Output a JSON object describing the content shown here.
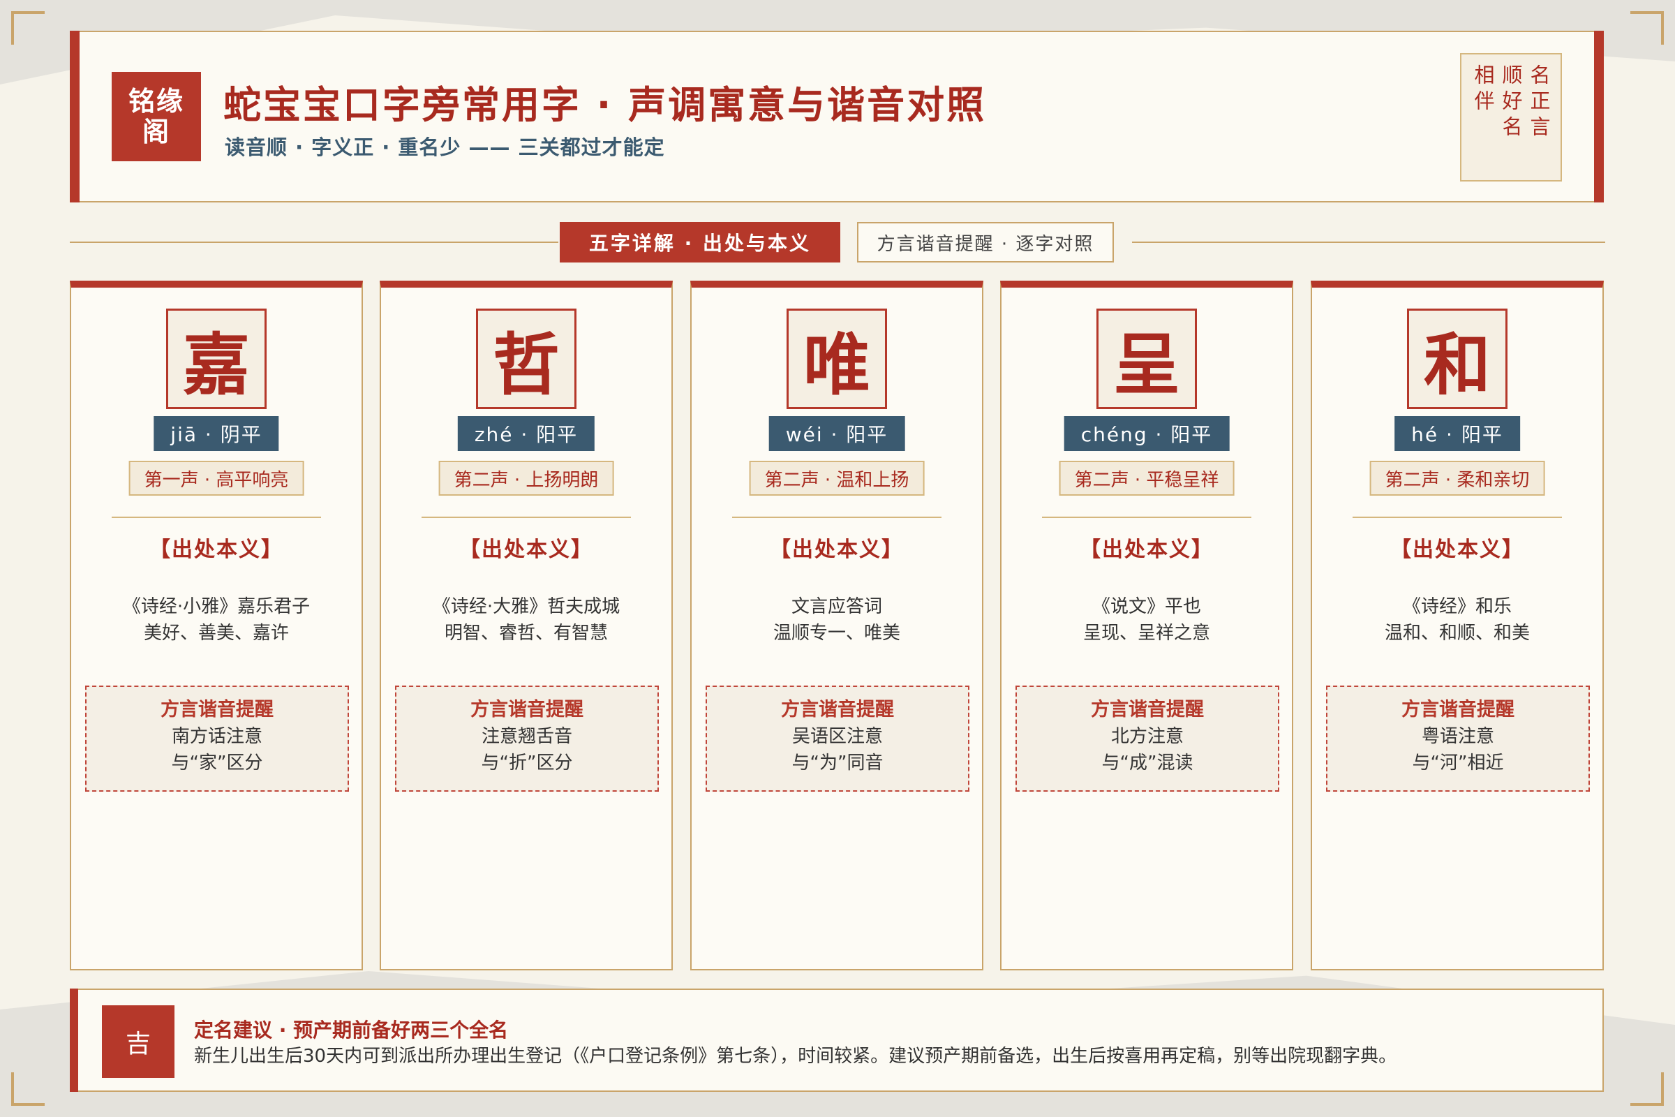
{
  "header": {
    "logo": [
      "铭缘",
      "阁"
    ],
    "title": "蛇宝宝口字旁常用字 · 声调寓意与谐音对照",
    "subtitle": "读音顺 · 字义正 · 重名少 —— 三关都过才能定",
    "seal_columns": [
      "名正言",
      "顺好名",
      "相伴"
    ]
  },
  "tabs": {
    "active": "五字详解 · 出处与本义",
    "inactive": "方言谐音提醒 · 逐字对照"
  },
  "cards": [
    {
      "char": "嘉",
      "pinyin": "jiā · 阴平",
      "tone": "第一声 · 高平响亮",
      "section_title": "【出处本义】",
      "origin": [
        "《诗经·小雅》嘉乐君子",
        "美好、善美、嘉许"
      ],
      "dialect_title": "方言谐音提醒",
      "dialect": [
        "南方话注意",
        "与“家”区分"
      ]
    },
    {
      "char": "哲",
      "pinyin": "zhé · 阳平",
      "tone": "第二声 · 上扬明朗",
      "section_title": "【出处本义】",
      "origin": [
        "《诗经·大雅》哲夫成城",
        "明智、睿哲、有智慧"
      ],
      "dialect_title": "方言谐音提醒",
      "dialect": [
        "注意翘舌音",
        "与“折”区分"
      ]
    },
    {
      "char": "唯",
      "pinyin": "wéi · 阳平",
      "tone": "第二声 · 温和上扬",
      "section_title": "【出处本义】",
      "origin": [
        "文言应答词",
        "温顺专一、唯美"
      ],
      "dialect_title": "方言谐音提醒",
      "dialect": [
        "吴语区注意",
        "与“为”同音"
      ]
    },
    {
      "char": "呈",
      "pinyin": "chéng · 阳平",
      "tone": "第二声 · 平稳呈祥",
      "section_title": "【出处本义】",
      "origin": [
        "《说文》平也",
        "呈现、呈祥之意"
      ],
      "dialect_title": "方言谐音提醒",
      "dialect": [
        "北方注意",
        "与“成”混读"
      ]
    },
    {
      "char": "和",
      "pinyin": "hé · 阳平",
      "tone": "第二声 · 柔和亲切",
      "section_title": "【出处本义】",
      "origin": [
        "《诗经》和乐",
        "温和、和顺、和美"
      ],
      "dialect_title": "方言谐音提醒",
      "dialect": [
        "粤语注意",
        "与“河”相近"
      ]
    }
  ],
  "footer": {
    "badge": "吉",
    "title": "定名建议 · 预产期前备好两三个全名",
    "text": "新生儿出生后30天内可到派出所办理出生登记（《户口登记条例》第七条），时间较紧。建议预产期前备选，出生后按喜用再定稿，别等出院现翻字典。"
  }
}
